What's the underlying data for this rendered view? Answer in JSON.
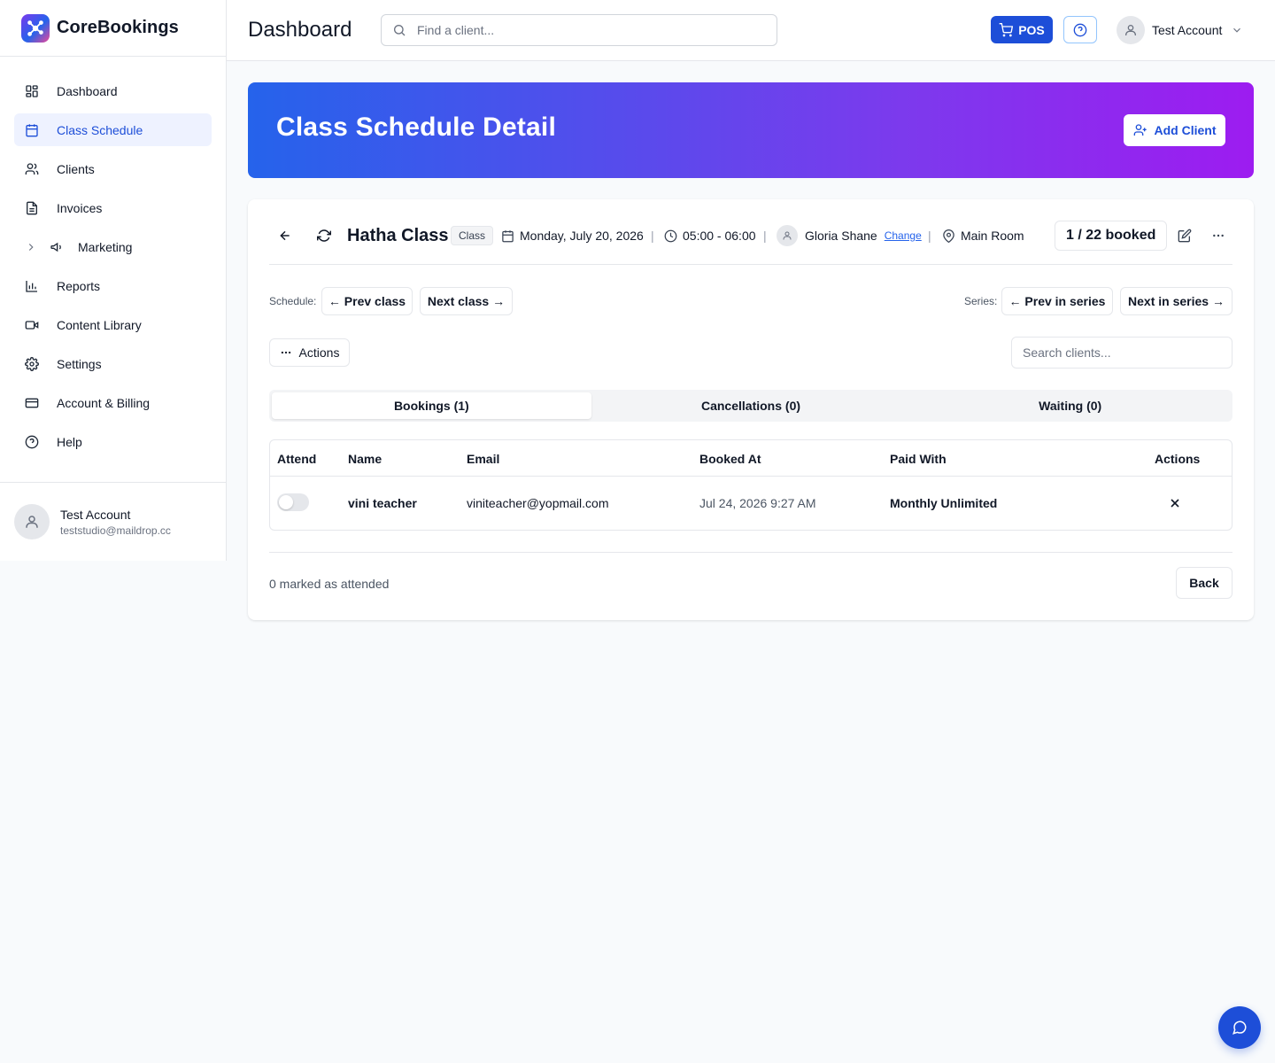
{
  "app": {
    "brand_name": "CoreBookings",
    "page_title": "Dashboard",
    "accent_color": "#1d4ed8"
  },
  "sidebar": {
    "items": [
      {
        "label": "Dashboard",
        "icon": "layout-grid-icon"
      },
      {
        "label": "Class Schedule",
        "icon": "calendar-icon",
        "active": true
      },
      {
        "label": "Clients",
        "icon": "users-icon"
      },
      {
        "label": "Invoices",
        "icon": "file-text-icon"
      },
      {
        "label": "Marketing",
        "icon": "megaphone-icon",
        "expandable": true
      },
      {
        "label": "Reports",
        "icon": "bar-chart-icon"
      },
      {
        "label": "Content Library",
        "icon": "video-icon"
      },
      {
        "label": "Settings",
        "icon": "gear-icon"
      },
      {
        "label": "Account & Billing",
        "icon": "credit-card-icon"
      },
      {
        "label": "Help",
        "icon": "help-circle-icon"
      }
    ],
    "user": {
      "name": "Test Account",
      "email": "teststudio@maildrop.cc"
    }
  },
  "topbar": {
    "search_placeholder": "Find a client...",
    "pos_label": "POS",
    "account_name": "Test Account"
  },
  "banner": {
    "title": "Class Schedule Detail",
    "add_client_label": "Add Client"
  },
  "class_info": {
    "name": "Hatha Class",
    "tag": "Class",
    "date": "Monday, July 20, 2026",
    "time": "05:00 - 06:00",
    "instructor": "Gloria Shane",
    "change_label": "Change",
    "room": "Main Room",
    "booked": "1 / 22 booked"
  },
  "navigation": {
    "schedule_label": "Schedule:",
    "prev_class": "← Prev class",
    "next_class": "Next class →",
    "series_label": "Series:",
    "prev_series": "← Prev in series",
    "next_series": "Next in series →"
  },
  "actions": {
    "actions_label": "Actions",
    "client_search_placeholder": "Search clients..."
  },
  "tabs": [
    {
      "label": "Bookings (1)",
      "active": true
    },
    {
      "label": "Cancellations (0)"
    },
    {
      "label": "Waiting (0)"
    }
  ],
  "table": {
    "columns": [
      "Attend",
      "Name",
      "Email",
      "Booked At",
      "Paid With",
      "Actions"
    ],
    "rows": [
      {
        "attend": false,
        "name": "vini teacher",
        "email": "viniteacher@yopmail.com",
        "booked_at": "Jul 24, 2026 9:27 AM",
        "paid_with": "Monthly Unlimited"
      }
    ]
  },
  "footer": {
    "attended_text": "0 marked as attended",
    "back_label": "Back"
  }
}
